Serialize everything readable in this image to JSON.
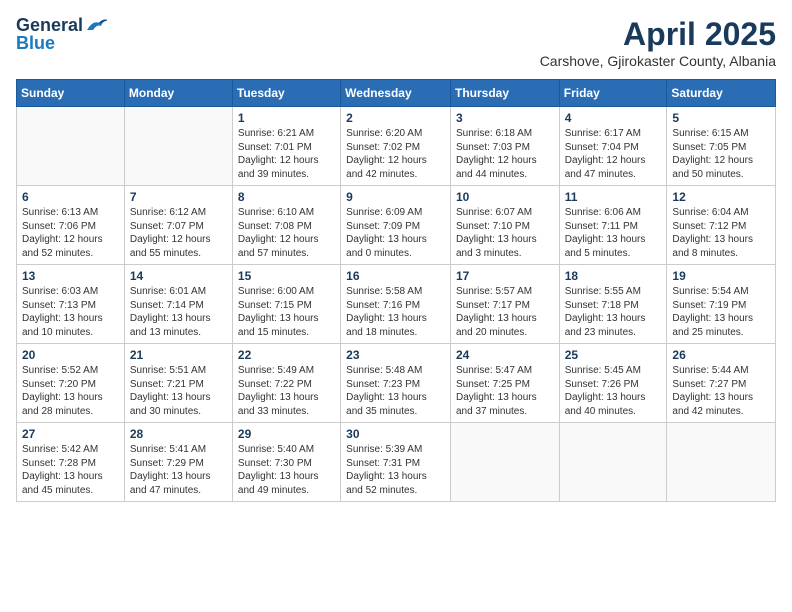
{
  "header": {
    "logo_general": "General",
    "logo_blue": "Blue",
    "month_title": "April 2025",
    "location": "Carshove, Gjirokaster County, Albania"
  },
  "weekdays": [
    "Sunday",
    "Monday",
    "Tuesday",
    "Wednesday",
    "Thursday",
    "Friday",
    "Saturday"
  ],
  "weeks": [
    [
      {
        "day": "",
        "content": ""
      },
      {
        "day": "",
        "content": ""
      },
      {
        "day": "1",
        "content": "Sunrise: 6:21 AM\nSunset: 7:01 PM\nDaylight: 12 hours\nand 39 minutes."
      },
      {
        "day": "2",
        "content": "Sunrise: 6:20 AM\nSunset: 7:02 PM\nDaylight: 12 hours\nand 42 minutes."
      },
      {
        "day": "3",
        "content": "Sunrise: 6:18 AM\nSunset: 7:03 PM\nDaylight: 12 hours\nand 44 minutes."
      },
      {
        "day": "4",
        "content": "Sunrise: 6:17 AM\nSunset: 7:04 PM\nDaylight: 12 hours\nand 47 minutes."
      },
      {
        "day": "5",
        "content": "Sunrise: 6:15 AM\nSunset: 7:05 PM\nDaylight: 12 hours\nand 50 minutes."
      }
    ],
    [
      {
        "day": "6",
        "content": "Sunrise: 6:13 AM\nSunset: 7:06 PM\nDaylight: 12 hours\nand 52 minutes."
      },
      {
        "day": "7",
        "content": "Sunrise: 6:12 AM\nSunset: 7:07 PM\nDaylight: 12 hours\nand 55 minutes."
      },
      {
        "day": "8",
        "content": "Sunrise: 6:10 AM\nSunset: 7:08 PM\nDaylight: 12 hours\nand 57 minutes."
      },
      {
        "day": "9",
        "content": "Sunrise: 6:09 AM\nSunset: 7:09 PM\nDaylight: 13 hours\nand 0 minutes."
      },
      {
        "day": "10",
        "content": "Sunrise: 6:07 AM\nSunset: 7:10 PM\nDaylight: 13 hours\nand 3 minutes."
      },
      {
        "day": "11",
        "content": "Sunrise: 6:06 AM\nSunset: 7:11 PM\nDaylight: 13 hours\nand 5 minutes."
      },
      {
        "day": "12",
        "content": "Sunrise: 6:04 AM\nSunset: 7:12 PM\nDaylight: 13 hours\nand 8 minutes."
      }
    ],
    [
      {
        "day": "13",
        "content": "Sunrise: 6:03 AM\nSunset: 7:13 PM\nDaylight: 13 hours\nand 10 minutes."
      },
      {
        "day": "14",
        "content": "Sunrise: 6:01 AM\nSunset: 7:14 PM\nDaylight: 13 hours\nand 13 minutes."
      },
      {
        "day": "15",
        "content": "Sunrise: 6:00 AM\nSunset: 7:15 PM\nDaylight: 13 hours\nand 15 minutes."
      },
      {
        "day": "16",
        "content": "Sunrise: 5:58 AM\nSunset: 7:16 PM\nDaylight: 13 hours\nand 18 minutes."
      },
      {
        "day": "17",
        "content": "Sunrise: 5:57 AM\nSunset: 7:17 PM\nDaylight: 13 hours\nand 20 minutes."
      },
      {
        "day": "18",
        "content": "Sunrise: 5:55 AM\nSunset: 7:18 PM\nDaylight: 13 hours\nand 23 minutes."
      },
      {
        "day": "19",
        "content": "Sunrise: 5:54 AM\nSunset: 7:19 PM\nDaylight: 13 hours\nand 25 minutes."
      }
    ],
    [
      {
        "day": "20",
        "content": "Sunrise: 5:52 AM\nSunset: 7:20 PM\nDaylight: 13 hours\nand 28 minutes."
      },
      {
        "day": "21",
        "content": "Sunrise: 5:51 AM\nSunset: 7:21 PM\nDaylight: 13 hours\nand 30 minutes."
      },
      {
        "day": "22",
        "content": "Sunrise: 5:49 AM\nSunset: 7:22 PM\nDaylight: 13 hours\nand 33 minutes."
      },
      {
        "day": "23",
        "content": "Sunrise: 5:48 AM\nSunset: 7:23 PM\nDaylight: 13 hours\nand 35 minutes."
      },
      {
        "day": "24",
        "content": "Sunrise: 5:47 AM\nSunset: 7:25 PM\nDaylight: 13 hours\nand 37 minutes."
      },
      {
        "day": "25",
        "content": "Sunrise: 5:45 AM\nSunset: 7:26 PM\nDaylight: 13 hours\nand 40 minutes."
      },
      {
        "day": "26",
        "content": "Sunrise: 5:44 AM\nSunset: 7:27 PM\nDaylight: 13 hours\nand 42 minutes."
      }
    ],
    [
      {
        "day": "27",
        "content": "Sunrise: 5:42 AM\nSunset: 7:28 PM\nDaylight: 13 hours\nand 45 minutes."
      },
      {
        "day": "28",
        "content": "Sunrise: 5:41 AM\nSunset: 7:29 PM\nDaylight: 13 hours\nand 47 minutes."
      },
      {
        "day": "29",
        "content": "Sunrise: 5:40 AM\nSunset: 7:30 PM\nDaylight: 13 hours\nand 49 minutes."
      },
      {
        "day": "30",
        "content": "Sunrise: 5:39 AM\nSunset: 7:31 PM\nDaylight: 13 hours\nand 52 minutes."
      },
      {
        "day": "",
        "content": ""
      },
      {
        "day": "",
        "content": ""
      },
      {
        "day": "",
        "content": ""
      }
    ]
  ]
}
